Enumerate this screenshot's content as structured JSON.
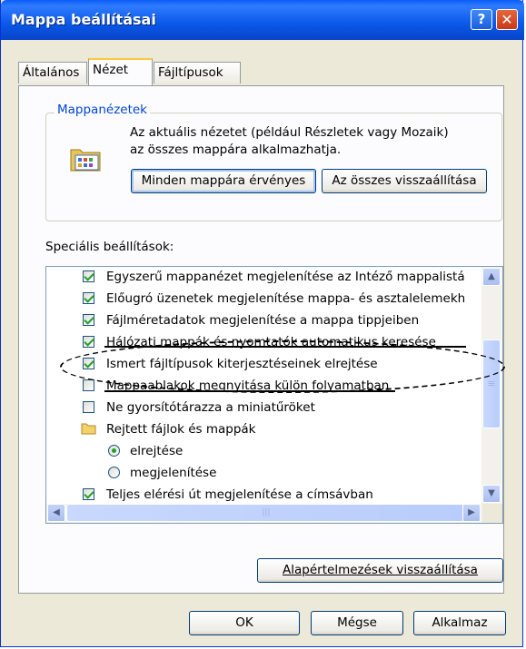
{
  "window": {
    "title": "Mappa beállításai",
    "help_glyph": "?",
    "close_glyph": "✕"
  },
  "tabs": [
    {
      "label": "Általános",
      "active": false
    },
    {
      "label": "Nézet",
      "active": true
    },
    {
      "label": "Fájltípusok",
      "active": false
    }
  ],
  "folder_views": {
    "legend": "Mappanézetek",
    "description_line1": "Az aktuális nézetet (például Részletek vagy Mozaik)",
    "description_line2": "az összes mappára alkalmazhatja.",
    "apply_button": "Minden mappára érvényes",
    "reset_button": "Az összes visszaállítása",
    "icon": "folder-view-icon"
  },
  "advanced": {
    "label": "Speciális beállítások:",
    "items": [
      {
        "type": "checkbox",
        "checked": true,
        "label": "Egyszerű mappanézet megjelenítése az Intéző mappalistá"
      },
      {
        "type": "checkbox",
        "checked": true,
        "label": "Előugró üzenetek megjelenítése mappa- és asztalelemekh"
      },
      {
        "type": "checkbox",
        "checked": true,
        "label": "Fájlméretadatok megjelenítése a mappa tippjeiben"
      },
      {
        "type": "checkbox",
        "checked": true,
        "label": "Hálózati mappák és nyomtatók automatikus keresése"
      },
      {
        "type": "checkbox",
        "checked": true,
        "label": "Ismert fájltípusok kiterjesztéseinek elrejtése"
      },
      {
        "type": "checkbox",
        "checked": false,
        "label": "Mappaablakok megnyitása külön folyamatban"
      },
      {
        "type": "checkbox",
        "checked": false,
        "label": "Ne gyorsítótárazza a miniatűröket"
      },
      {
        "type": "folder",
        "label": "Rejtett fájlok és mappák"
      },
      {
        "type": "radio",
        "checked": true,
        "label": "elrejtése"
      },
      {
        "type": "radio",
        "checked": false,
        "label": "megjelenítése"
      },
      {
        "type": "checkbox",
        "checked": true,
        "label": "Teljes elérési út megjelenítése a címsávban"
      }
    ]
  },
  "scrollbar": {
    "up": "▲",
    "down": "▼",
    "left": "◀",
    "right": "▶",
    "grip": "≡",
    "hgrip": "|||"
  },
  "restore_defaults_button": "Alapértelmezések visszaállítása",
  "footer": {
    "ok": "OK",
    "cancel": "Mégse",
    "apply": "Alkalmaz"
  },
  "colors": {
    "titlebar": "#0a58e8",
    "accent_tab": "#ffc83c",
    "check": "#21a121"
  }
}
